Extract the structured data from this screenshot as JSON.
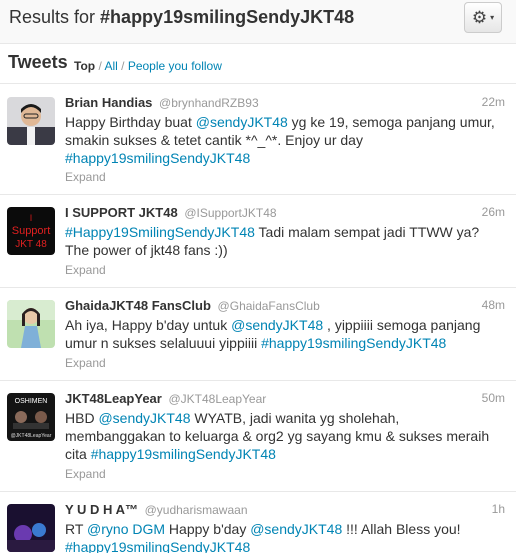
{
  "header": {
    "results_prefix": "Results for",
    "query": "#happy19smilingSendyJKT48",
    "gear_icon": "gear-icon",
    "caret": "▾"
  },
  "tweets_header": {
    "title": "Tweets",
    "filter_top": "Top",
    "sep1": " / ",
    "filter_all": "All",
    "sep2": " / ",
    "filter_follow": "People you follow"
  },
  "tweets": [
    {
      "name": "Brian Handias",
      "handle": "@brynhandRZB93",
      "time": "22m",
      "text": [
        {
          "t": "Happy Birthday buat "
        },
        {
          "t": "@sendyJKT48",
          "link": true
        },
        {
          "t": " yg ke 19, semoga panjang umur, smakin sukses & tetet cantik *^_^*. Enjoy ur day "
        },
        {
          "t": "#happy19smilingSendyJKT48",
          "link": true
        }
      ],
      "expand": "Expand"
    },
    {
      "name": "I SUPPORT JKT48",
      "handle": "@ISupportJKT48",
      "time": "26m",
      "text": [
        {
          "t": "#Happy19SmilingSendyJKT48",
          "link": true
        },
        {
          "t": " Tadi malam sempat jadi TTWW ya? The power of jkt48 fans :))"
        }
      ],
      "expand": "Expand"
    },
    {
      "name": "GhaidaJKT48 FansClub",
      "handle": "@GhaidaFansClub",
      "time": "48m",
      "text": [
        {
          "t": "Ah iya, Happy b'day untuk "
        },
        {
          "t": "@sendyJKT48",
          "link": true
        },
        {
          "t": " , yippiiii semoga panjang umur n sukses selaluuui yippiiii "
        },
        {
          "t": "#happy19smilingSendyJKT48",
          "link": true
        }
      ],
      "expand": "Expand"
    },
    {
      "name": "JKT48LeapYear",
      "handle": "@JKT48LeapYear",
      "time": "50m",
      "text": [
        {
          "t": "HBD "
        },
        {
          "t": "@sendyJKT48",
          "link": true
        },
        {
          "t": " WYATB, jadi wanita yg sholehah, membanggakan to keluarga & org2 yg sayang kmu & sukses meraih cita "
        },
        {
          "t": "#happy19smilingSendyJKT48",
          "link": true
        }
      ],
      "expand": "Expand"
    },
    {
      "name": "Y U D H A™",
      "handle": "@yudharismawaan",
      "time": "1h",
      "text": [
        {
          "t": "RT "
        },
        {
          "t": "@ryno DGM",
          "link": true
        },
        {
          "t": " Happy b'day "
        },
        {
          "t": "@sendyJKT48",
          "link": true
        },
        {
          "t": " !!! Allah Bless you! "
        },
        {
          "t": "#happy19smilingSendyJKT48",
          "link": true
        }
      ],
      "expand": ""
    }
  ],
  "avatar_labels": {
    "isupport": [
      "I",
      "Support",
      "JKT 48"
    ],
    "leapyear": [
      "OSHIMEN",
      "@JKT48LeapYear"
    ]
  },
  "colors": {
    "link": "#0084b4",
    "muted": "#999999",
    "text": "#333333"
  }
}
